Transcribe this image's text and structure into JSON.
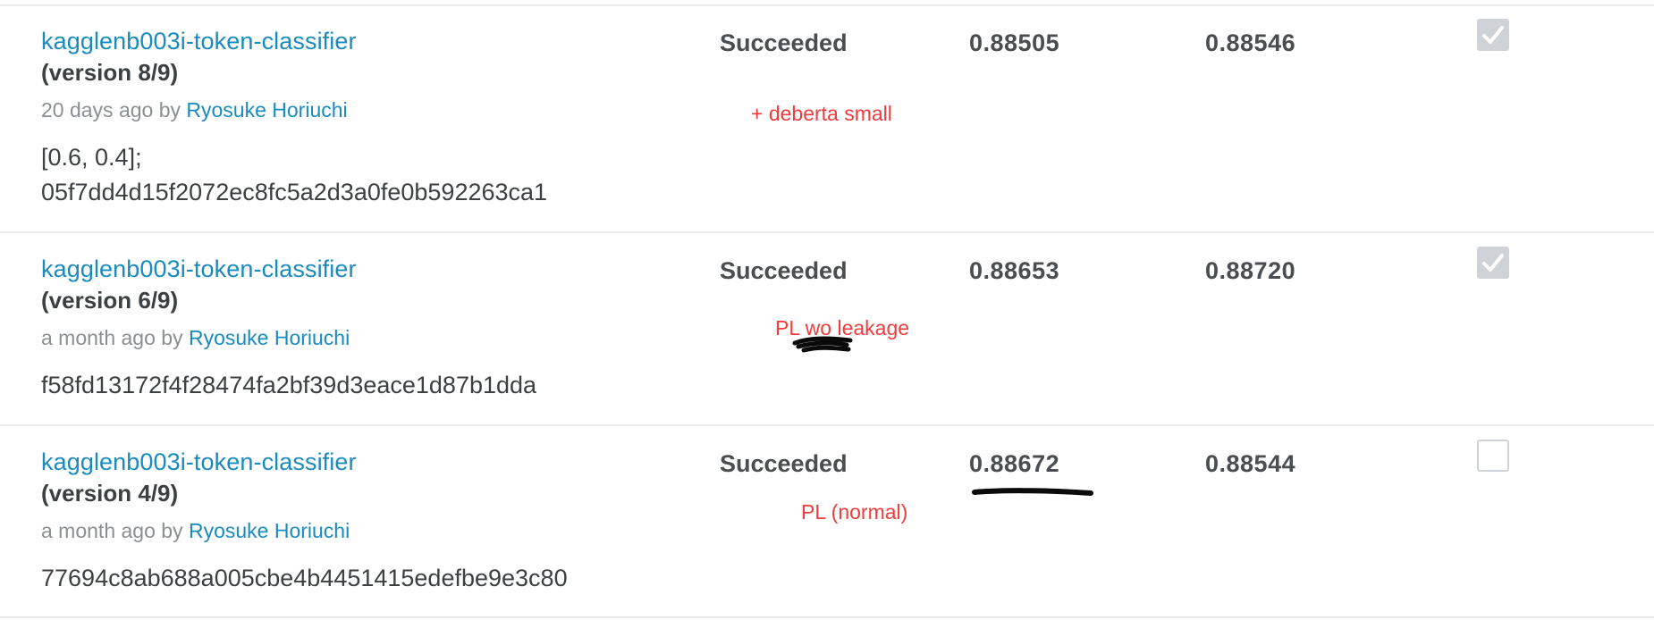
{
  "submissions": [
    {
      "title": "kagglenb003i-token-classifier",
      "version": "(version 8/9)",
      "time": "20 days ago by",
      "author": "Ryosuke Horiuchi",
      "desc_line1": "[0.6, 0.4];",
      "desc_line2": "05f7dd4d15f2072ec8fc5a2d3a0fe0b592263ca1",
      "status": "Succeeded",
      "public_score": "0.88505",
      "private_score": "0.88546",
      "annotation": "+ deberta small",
      "selected": true
    },
    {
      "title": "kagglenb003i-token-classifier",
      "version": "(version 6/9)",
      "time": "a month ago by",
      "author": "Ryosuke Horiuchi",
      "desc_line1": "f58fd13172f4f28474fa2bf39d3eace1d87b1dda",
      "status": "Succeeded",
      "public_score": "0.88653",
      "private_score": "0.88720",
      "annotation": "PL wo leakage",
      "selected": true
    },
    {
      "title": "kagglenb003i-token-classifier",
      "version": "(version 4/9)",
      "time": "a month ago by",
      "author": "Ryosuke Horiuchi",
      "desc_line1": "77694c8ab688a005cbe4b4451415edefbe9e3c80",
      "status": "Succeeded",
      "public_score": "0.88672",
      "private_score": "0.88544",
      "annotation": "PL (normal)",
      "selected": false
    }
  ],
  "icons": {
    "checked": "checkmark-icon"
  },
  "colors": {
    "link": "#1a8bbf",
    "annotation": "#f03c3c",
    "checkbox": "#cfd3d7"
  }
}
